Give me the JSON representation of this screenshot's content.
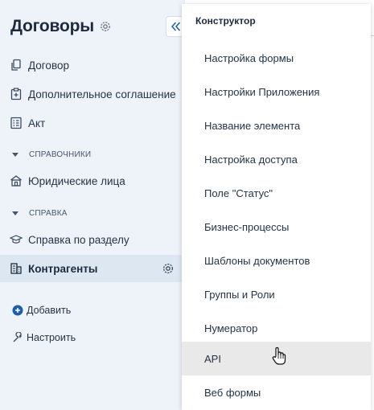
{
  "sidebar": {
    "title": "Договоры",
    "nav_top": [
      {
        "label": "Договор",
        "icon": "copy-icon"
      },
      {
        "label": "Дополнительное соглашение",
        "icon": "clipboard-plus-icon"
      },
      {
        "label": "Акт",
        "icon": "checklist-icon"
      }
    ],
    "section_directories": "СПРАВОЧНИКИ",
    "directory_items": [
      {
        "label": "Юридические лица",
        "icon": "building-icon"
      }
    ],
    "section_help": "СПРАВКА",
    "help_items": [
      {
        "label": "Справка по разделу",
        "icon": "graduation-cap-icon"
      },
      {
        "label": "Контрагенты",
        "icon": "office-building-icon",
        "active": true
      }
    ],
    "actions": {
      "add_label": "Добавить",
      "configure_label": "Настроить"
    }
  },
  "menu": {
    "header": "Конструктор",
    "items": [
      {
        "label": "Настройка формы"
      },
      {
        "label": "Настройки Приложения"
      },
      {
        "label": "Название элемента"
      },
      {
        "label": "Настройка доступа"
      },
      {
        "label": "Поле \"Статус\""
      },
      {
        "label": "Бизнес-процессы"
      },
      {
        "label": "Шаблоны документов"
      },
      {
        "label": "Группы и Роли"
      },
      {
        "label": "Нумератор"
      },
      {
        "label": "API",
        "hover": true
      },
      {
        "label": "Веб формы"
      }
    ]
  },
  "colors": {
    "sidebar_bg": "#eef3f9",
    "active_bg": "#dde7f2",
    "hover_bg": "#e9e9e9",
    "accent": "#1b5fa8",
    "text": "#243447"
  }
}
